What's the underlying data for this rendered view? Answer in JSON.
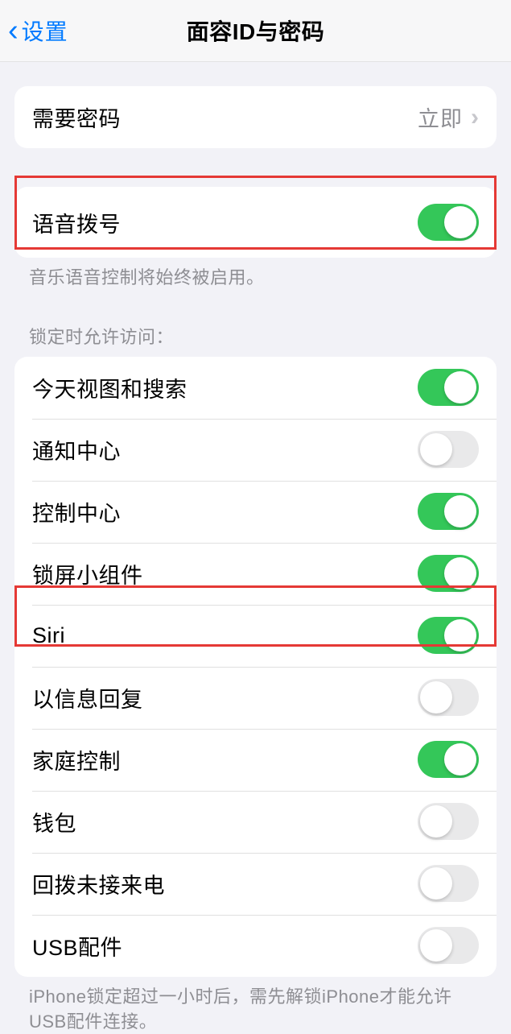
{
  "header": {
    "back_label": "设置",
    "title": "面容ID与密码"
  },
  "passcode_row": {
    "label": "需要密码",
    "value": "立即"
  },
  "voice_dial": {
    "label": "语音拨号",
    "on": true,
    "footer": "音乐语音控制将始终被启用。"
  },
  "lock_access": {
    "header": "锁定时允许访问：",
    "items": [
      {
        "label": "今天视图和搜索",
        "on": true
      },
      {
        "label": "通知中心",
        "on": false
      },
      {
        "label": "控制中心",
        "on": true
      },
      {
        "label": "锁屏小组件",
        "on": true
      },
      {
        "label": "Siri",
        "on": true
      },
      {
        "label": "以信息回复",
        "on": false
      },
      {
        "label": "家庭控制",
        "on": true
      },
      {
        "label": "钱包",
        "on": false
      },
      {
        "label": "回拨未接来电",
        "on": false
      },
      {
        "label": "USB配件",
        "on": false
      }
    ],
    "footer": "iPhone锁定超过一小时后，需先解锁iPhone才能允许USB配件连接。"
  }
}
